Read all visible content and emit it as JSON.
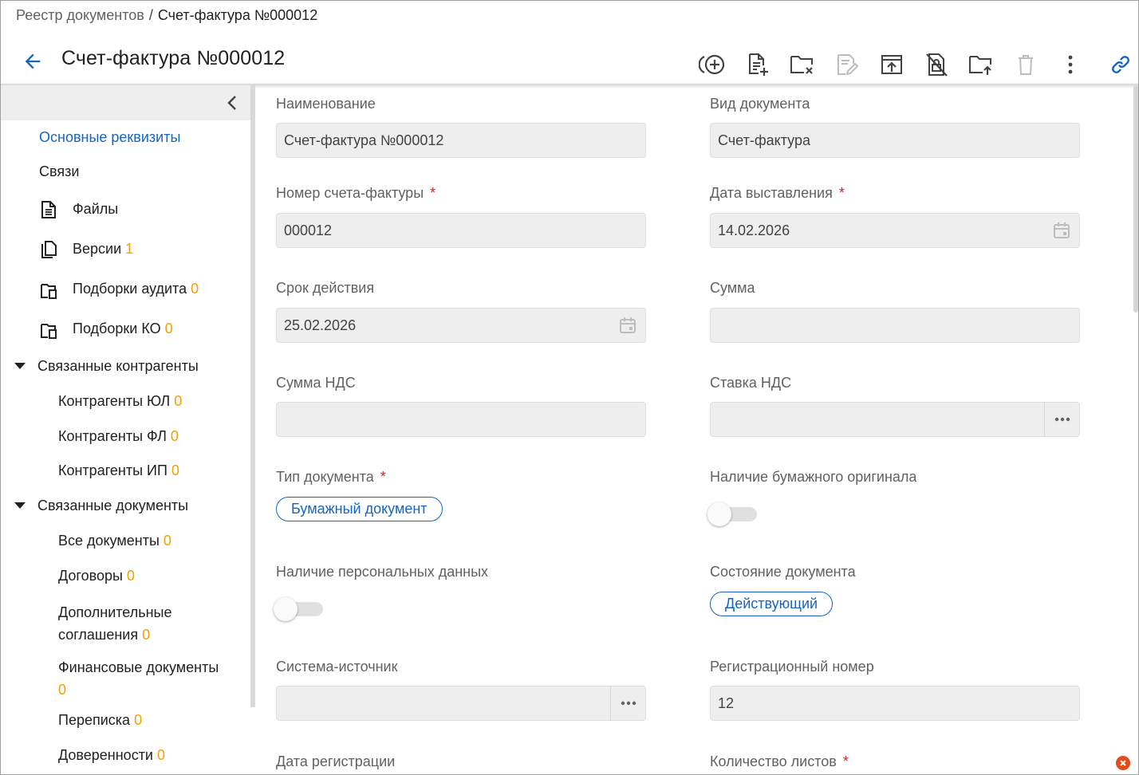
{
  "breadcrumb": {
    "parent": "Реестр документов",
    "separator": "/",
    "current": "Счет-фактура №000012"
  },
  "header": {
    "title": "Счет-фактура №000012"
  },
  "toolbar": {
    "icons": [
      "add-circle-icon",
      "add-document-icon",
      "folder-remove-icon",
      "edit-document-icon",
      "upload-icon",
      "lock-off-icon",
      "folder-upload-icon",
      "trash-icon",
      "more-vertical-icon",
      "link-icon"
    ]
  },
  "sidebar": {
    "items": [
      {
        "label": "Основные реквизиты",
        "count": "",
        "active": true
      },
      {
        "label": "Связи",
        "count": ""
      },
      {
        "label": "Файлы",
        "count": ""
      },
      {
        "label": "Версии",
        "count": "1"
      },
      {
        "label": "Подборки аудита",
        "count": "0"
      },
      {
        "label": "Подборки КО",
        "count": "0"
      }
    ],
    "groups": [
      {
        "label": "Связанные контрагенты",
        "items": [
          {
            "label": "Контрагенты ЮЛ",
            "count": "0"
          },
          {
            "label": "Контрагенты ФЛ",
            "count": "0"
          },
          {
            "label": "Контрагенты ИП",
            "count": "0"
          }
        ]
      },
      {
        "label": "Связанные документы",
        "items": [
          {
            "label": "Все документы",
            "count": "0"
          },
          {
            "label": "Договоры",
            "count": "0"
          },
          {
            "label_line1": "Дополнительные",
            "label_line2": "соглашения",
            "count": "0"
          },
          {
            "label": "Финансовые документы",
            "count": "0"
          },
          {
            "label": "Переписка",
            "count": "0"
          },
          {
            "label": "Доверенности",
            "count": "0"
          }
        ]
      }
    ]
  },
  "form": {
    "name": {
      "label": "Наименование",
      "value": "Счет-фактура №000012"
    },
    "doc_kind": {
      "label": "Вид документа",
      "value": "Счет-фактура"
    },
    "invoice_number": {
      "label": "Номер счета-фактуры",
      "required": "*",
      "value": "000012"
    },
    "issue_date": {
      "label": "Дата выставления",
      "required": "*",
      "value": "14.02.2026"
    },
    "validity": {
      "label": "Срок действия",
      "value": "25.02.2026"
    },
    "amount": {
      "label": "Сумма",
      "value": ""
    },
    "vat_amount": {
      "label": "Сумма НДС",
      "value": ""
    },
    "vat_rate": {
      "label": "Ставка НДС",
      "value": ""
    },
    "doc_type": {
      "label": "Тип документа",
      "required": "*",
      "value": "Бумажный документ"
    },
    "paper_original": {
      "label": "Наличие бумажного оригинала",
      "on": false
    },
    "personal_data": {
      "label": "Наличие персональных данных",
      "on": false
    },
    "doc_state": {
      "label": "Состояние документа",
      "value": "Действующий"
    },
    "source_system": {
      "label": "Система-источник",
      "value": ""
    },
    "reg_number": {
      "label": "Регистрационный номер",
      "value": "12"
    },
    "reg_date": {
      "label": "Дата регистрации"
    },
    "sheets": {
      "label": "Количество листов",
      "required": "*"
    }
  },
  "colors": {
    "accent": "#1565c0",
    "count": "#f5a000",
    "required": "#c62828",
    "field_bg": "#eeeeee"
  }
}
